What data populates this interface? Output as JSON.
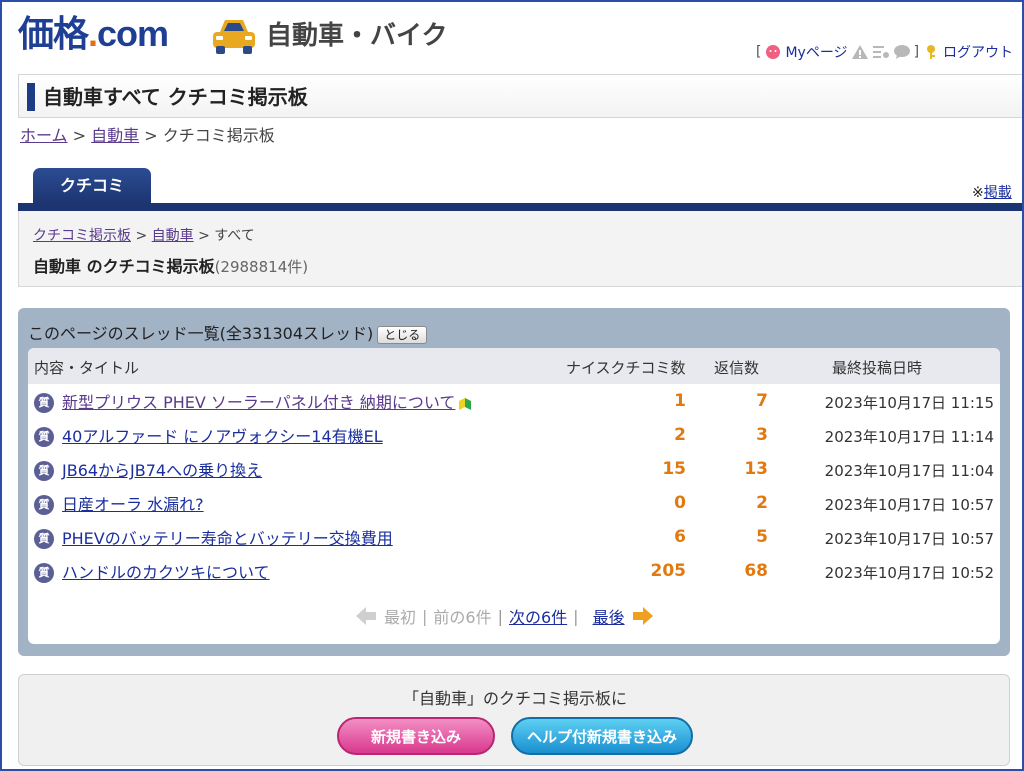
{
  "header": {
    "logo_kakaku": "価格",
    "logo_dot": ".",
    "logo_com": "com",
    "category": "自動車・バイク",
    "userbar": {
      "bracket_open": "[",
      "mypage": "Myページ",
      "bracket_close": "]",
      "logout": "ログアウト"
    }
  },
  "page_title": "自動車すべて クチコミ掲示板",
  "breadcrumb": {
    "home": "ホーム",
    "sep": ">",
    "car": "自動車",
    "current": "クチコミ掲示板"
  },
  "tab": {
    "label": "クチコミ"
  },
  "note": {
    "prefix": "※",
    "link": "掲載"
  },
  "sub": {
    "crumb1": "クチコミ掲示板",
    "crumb2": "自動車",
    "crumb3": "すべて",
    "sep": ">",
    "title": "自動車 のクチコミ掲示板",
    "count": "(2988814件)"
  },
  "threads": {
    "header": "このページのスレッド一覧(全331304スレッド)",
    "close": "とじる",
    "columns": {
      "title": "内容・タイトル",
      "nice": "ナイスクチコミ数",
      "replies": "返信数",
      "last": "最終投稿日時"
    },
    "rows": [
      {
        "icon": "質",
        "title": "新型プリウス PHEV ソーラーパネル付き 納期について",
        "nice": "1",
        "replies": "7",
        "date": "2023年10月17日 11:15",
        "beginner": true,
        "visited": true
      },
      {
        "icon": "質",
        "title": "40アルファード にノアヴォクシー14有機EL",
        "nice": "2",
        "replies": "3",
        "date": "2023年10月17日 11:14",
        "beginner": false,
        "visited": false
      },
      {
        "icon": "質",
        "title": "JB64からJB74への乗り換え",
        "nice": "15",
        "replies": "13",
        "date": "2023年10月17日 11:04",
        "beginner": false,
        "visited": false
      },
      {
        "icon": "質",
        "title": "日産オーラ 水漏れ?",
        "nice": "0",
        "replies": "2",
        "date": "2023年10月17日 10:57",
        "beginner": false,
        "visited": false
      },
      {
        "icon": "質",
        "title": "PHEVのバッテリー寿命とバッテリー交換費用",
        "nice": "6",
        "replies": "5",
        "date": "2023年10月17日 10:57",
        "beginner": false,
        "visited": false
      },
      {
        "icon": "質",
        "title": "ハンドルのカクツキについて",
        "nice": "205",
        "replies": "68",
        "date": "2023年10月17日 10:52",
        "beginner": false,
        "visited": false
      }
    ],
    "pager": {
      "first": "最初",
      "prev": "前の6件",
      "next": "次の6件",
      "last": "最後",
      "sep": "|"
    }
  },
  "post": {
    "text": "「自動車」のクチコミ掲示板に",
    "new_btn": "新規書き込み",
    "help_btn": "ヘルプ付新規書き込み"
  },
  "colors": {
    "navy": "#1c3570",
    "accent_orange": "#e07a10",
    "panel_blue": "#a2b3c6"
  }
}
